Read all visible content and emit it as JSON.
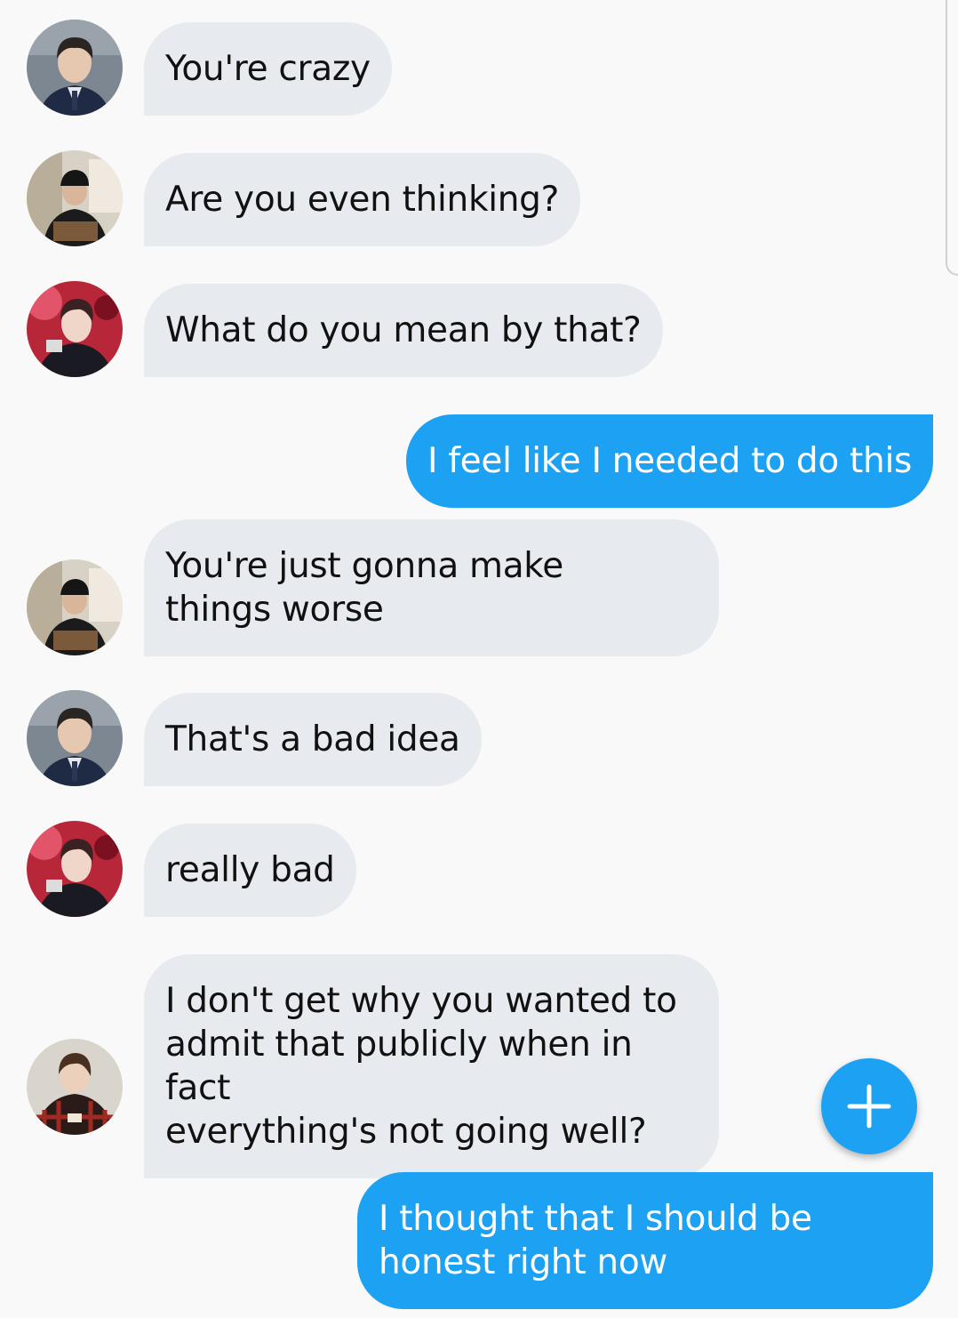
{
  "messages": [
    {
      "direction": "in",
      "avatar": "member-suit",
      "text": "You're crazy"
    },
    {
      "direction": "in",
      "avatar": "member-cap",
      "text": "Are you even thinking?"
    },
    {
      "direction": "in",
      "avatar": "member-stage",
      "text": "What do you mean by that?"
    },
    {
      "direction": "out",
      "text": "I feel like I needed to do this"
    },
    {
      "direction": "in",
      "avatar": "member-cap",
      "text": "You're just gonna make\nthings worse"
    },
    {
      "direction": "in",
      "avatar": "member-suit",
      "text": "That's a bad idea"
    },
    {
      "direction": "in",
      "avatar": "member-stage",
      "text": "really bad"
    },
    {
      "direction": "in",
      "avatar": "member-plaid",
      "text": "I don't get why you wanted to\nadmit that publicly when in fact\neverything's not going well?"
    },
    {
      "direction": "out",
      "text": "I thought that I should be\nhonest right now"
    }
  ],
  "compose_button": {
    "icon": "plus-icon"
  },
  "colors": {
    "background": "#f9f9f9",
    "incoming_bubble": "#e7ebef",
    "outgoing_bubble": "#1da1f2",
    "fab": "#1da1f2"
  }
}
